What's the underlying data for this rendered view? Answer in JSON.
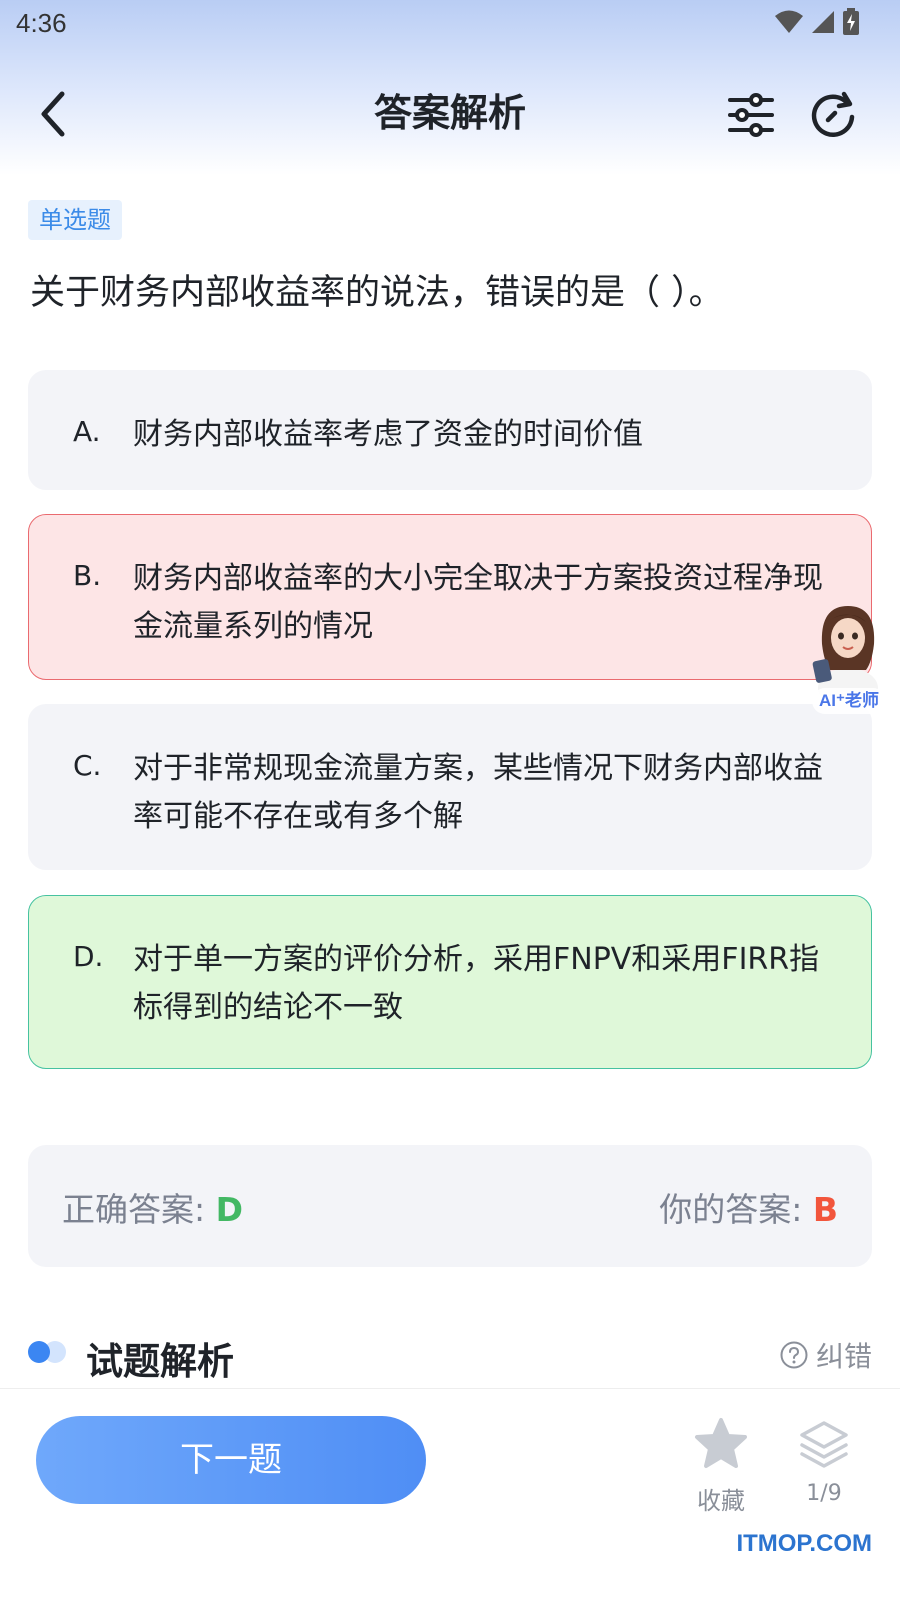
{
  "status_bar": {
    "time": "4:36"
  },
  "header": {
    "title": "答案解析"
  },
  "question": {
    "type_tag": "单选题",
    "text": "关于财务内部收益率的说法，错误的是（ ）。"
  },
  "options": [
    {
      "letter": "A.",
      "text": "财务内部收益率考虑了资金的时间价值",
      "state": "normal"
    },
    {
      "letter": "B.",
      "text": "财务内部收益率的大小完全取决于方案投资过程净现金流量系列的情况",
      "state": "wrong"
    },
    {
      "letter": "C.",
      "text": "对于非常规现金流量方案，某些情况下财务内部收益率可能不存在或有多个解",
      "state": "normal"
    },
    {
      "letter": "D.",
      "text": "对于单一方案的评价分析，采用FNPV和采用FIRR指标得到的结论不一致",
      "state": "correct"
    }
  ],
  "answer": {
    "correct_label": "正确答案: ",
    "correct_value": "D",
    "mine_label": "你的答案: ",
    "mine_value": "B"
  },
  "analysis": {
    "title": "试题解析",
    "report_label": "纠错"
  },
  "ai_teacher": {
    "label": "AI⁺老师"
  },
  "bottom_bar": {
    "next_label": "下一题",
    "favorite_label": "收藏",
    "progress": "1/9"
  },
  "watermark": "ITMOP.COM",
  "colors": {
    "accent": "#4f8ef5",
    "wrong_bg": "#fde5e6",
    "wrong_border": "#ea6a6f",
    "correct_bg": "#dff8d9",
    "correct_border": "#46c2a0",
    "correct_text": "#43b864",
    "mine_text": "#f2553c"
  }
}
